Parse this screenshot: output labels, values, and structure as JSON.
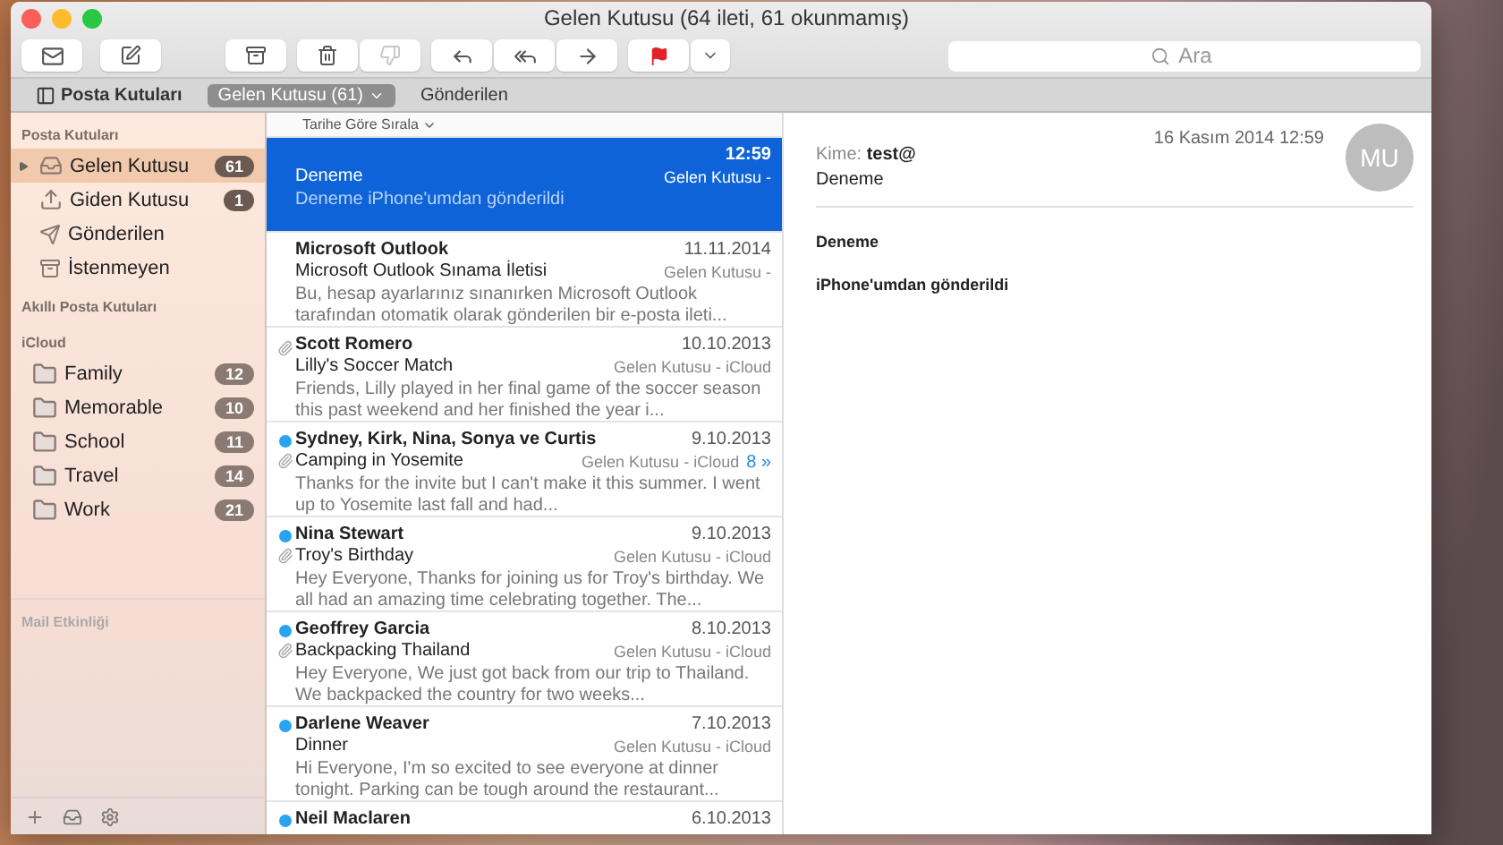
{
  "window": {
    "title": "Gelen Kutusu (64 ileti, 61 okunmamış)"
  },
  "toolbar": {
    "buttons": [
      {
        "kind": "get-mail",
        "disabled": false
      },
      {
        "kind": "compose",
        "disabled": false
      },
      {
        "kind": "archive",
        "disabled": false
      },
      {
        "kind": "delete",
        "disabled": false
      },
      {
        "kind": "junk",
        "disabled": true
      },
      {
        "kind": "reply",
        "disabled": false
      },
      {
        "kind": "reply-all",
        "disabled": false
      },
      {
        "kind": "forward",
        "disabled": false
      },
      {
        "kind": "flag",
        "disabled": false
      }
    ],
    "search": {
      "placeholder": "Ara"
    }
  },
  "favorites_bar": [
    {
      "label": "Posta Kutuları",
      "kind": "sidebar-toggle",
      "selected": false
    },
    {
      "label": "Gelen Kutusu (61)",
      "kind": "mailbox",
      "selected": true
    },
    {
      "label": "Gönderilen",
      "kind": "mailbox",
      "selected": false
    }
  ],
  "sidebar": {
    "sections": [
      {
        "title": "Posta Kutuları",
        "items": [
          {
            "label": "Gelen Kutusu",
            "kind": "inbox",
            "count": "61",
            "selected": true,
            "expandable": true
          },
          {
            "label": "Giden Kutusu",
            "kind": "outbox",
            "count": "1",
            "selected": false,
            "expandable": false
          },
          {
            "label": "Gönderilen",
            "kind": "sent",
            "selected": false,
            "expandable": false
          },
          {
            "label": "İstenmeyen",
            "kind": "junk",
            "selected": false,
            "expandable": false
          }
        ]
      },
      {
        "title": "Akıllı Posta Kutuları"
      },
      {
        "title": "iCloud",
        "items": [
          {
            "label": "Family",
            "kind": "folder",
            "count": "12",
            "selected": false
          },
          {
            "label": "Memorable",
            "kind": "folder",
            "count": "10",
            "selected": false
          },
          {
            "label": "School",
            "kind": "folder",
            "count": "11",
            "selected": false
          },
          {
            "label": "Travel",
            "kind": "folder",
            "count": "14",
            "selected": false
          },
          {
            "label": "Work",
            "kind": "folder",
            "count": "21",
            "selected": false
          }
        ]
      }
    ],
    "activity_title": "Mail Etkinliği"
  },
  "message_list": {
    "sort_label": "Tarihe Göre Sırala",
    "messages": [
      {
        "date": "12:59",
        "subject": "Deneme",
        "mailbox": "Gelen Kutusu -",
        "preview": "Deneme iPhone'umdan gönderildi",
        "selected": true,
        "unread": false,
        "attachment": false
      },
      {
        "sender": "Microsoft Outlook",
        "date": "11.11.2014",
        "subject": "Microsoft Outlook Sınama İletisi",
        "mailbox": "Gelen Kutusu -",
        "preview": "Bu, hesap ayarlarınız sınanırken Microsoft Outlook tarafından otomatik olarak gönderilen bir e-posta ileti...",
        "selected": false,
        "unread": false,
        "attachment": false
      },
      {
        "sender": "Scott Romero",
        "date": "10.10.2013",
        "subject": "Lilly's Soccer Match",
        "mailbox": "Gelen Kutusu - iCloud",
        "preview": "Friends, Lilly played in her final game of the soccer season this past weekend and her finished the year i...",
        "selected": false,
        "unread": false,
        "attachment": true
      },
      {
        "sender": "Sydney, Kirk, Nina, Sonya ve Curtis",
        "date": "9.10.2013",
        "subject": "Camping in Yosemite",
        "mailbox": "Gelen Kutusu - iCloud",
        "thread_count": "8",
        "thread_arrow": "»",
        "preview": "Thanks for the invite but I can't make it this summer. I went up to Yosemite last fall and had...",
        "selected": false,
        "unread": true,
        "attachment": true
      },
      {
        "sender": "Nina Stewart",
        "date": "9.10.2013",
        "subject": "Troy's Birthday",
        "mailbox": "Gelen Kutusu - iCloud",
        "preview": "Hey Everyone, Thanks for joining us for Troy's birthday. We all had an amazing time celebrating together. The...",
        "selected": false,
        "unread": true,
        "attachment": true
      },
      {
        "sender": "Geoffrey Garcia",
        "date": "8.10.2013",
        "subject": "Backpacking Thailand",
        "mailbox": "Gelen Kutusu - iCloud",
        "preview": "Hey Everyone, We just got back from our trip to Thailand. We backpacked the country for two weeks...",
        "selected": false,
        "unread": true,
        "attachment": true
      },
      {
        "sender": "Darlene Weaver",
        "date": "7.10.2013",
        "subject": "Dinner",
        "mailbox": "Gelen Kutusu - iCloud",
        "preview": "Hi Everyone, I'm so excited to see everyone at dinner tonight. Parking can be tough around the restaurant...",
        "selected": false,
        "unread": true,
        "attachment": false
      },
      {
        "sender": "Neil Maclaren",
        "date": "6.10.2013",
        "selected": false,
        "unread": true,
        "attachment": false
      }
    ]
  },
  "reader": {
    "date": "16 Kasım 2014 12:59",
    "to_label": "Kime:",
    "to": "test@",
    "subject": "Deneme",
    "avatar": "MU",
    "body": [
      "Deneme",
      "iPhone'umdan gönderildi"
    ]
  }
}
